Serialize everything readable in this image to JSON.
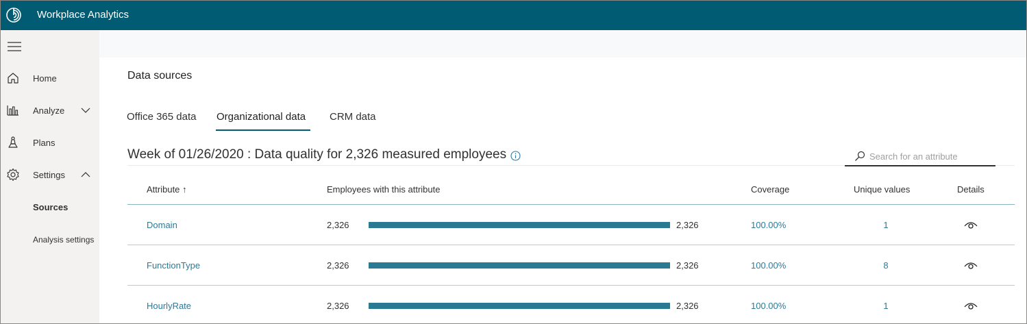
{
  "app": {
    "title": "Workplace Analytics",
    "accent_color": "#015c73",
    "logo_icon": "workplace-analytics-logo"
  },
  "sidebar": {
    "items": [
      {
        "label": "Home",
        "icon": "home-icon"
      },
      {
        "label": "Analyze",
        "icon": "chart-icon",
        "chevron": "down"
      },
      {
        "label": "Plans",
        "icon": "plans-icon"
      },
      {
        "label": "Settings",
        "icon": "gear-icon",
        "chevron": "up"
      }
    ],
    "sub_items": [
      {
        "label": "Sources",
        "active": true
      },
      {
        "label": "Analysis settings",
        "active": false
      }
    ]
  },
  "page": {
    "title": "Data sources",
    "tabs": [
      {
        "label": "Office 365 data",
        "active": false
      },
      {
        "label": "Organizational data",
        "active": true
      },
      {
        "label": "CRM data",
        "active": false
      }
    ],
    "heading": "Week of 01/26/2020 :  Data quality for 2,326 measured employees",
    "search_placeholder": "Search for an attribute"
  },
  "table": {
    "columns": [
      {
        "label": "Attribute ↑"
      },
      {
        "label": "Employees with this attribute"
      },
      {
        "label": "Coverage"
      },
      {
        "label": "Unique values"
      },
      {
        "label": "Details"
      }
    ],
    "rows": [
      {
        "attribute": "Domain",
        "count": "2,326",
        "total": "2,326",
        "fraction": 1.0,
        "coverage": "100.00%",
        "unique": "1"
      },
      {
        "attribute": "FunctionType",
        "count": "2,326",
        "total": "2,326",
        "fraction": 1.0,
        "coverage": "100.00%",
        "unique": "8"
      },
      {
        "attribute": "HourlyRate",
        "count": "2,326",
        "total": "2,326",
        "fraction": 1.0,
        "coverage": "100.00%",
        "unique": "1"
      }
    ]
  }
}
